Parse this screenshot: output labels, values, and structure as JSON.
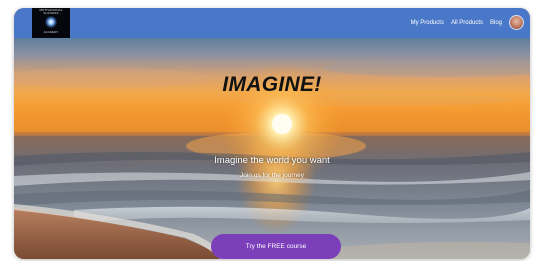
{
  "header": {
    "logo": {
      "title": "MOTIVATIONAL SUCCESS",
      "tagline": "ACADEMY"
    },
    "nav": [
      {
        "label": "My Products"
      },
      {
        "label": "All Products"
      },
      {
        "label": "Blog"
      }
    ],
    "avatar_alt": "user avatar",
    "bar_color": "#4a78c8"
  },
  "hero": {
    "title": "IMAGINE!",
    "subtitle": "Imagine the world you want",
    "subtitle2": "Join us for the journey",
    "cta_label": "Try the FREE course",
    "cta_color": "#7b3fb9",
    "background": "sunset over ocean beach"
  }
}
